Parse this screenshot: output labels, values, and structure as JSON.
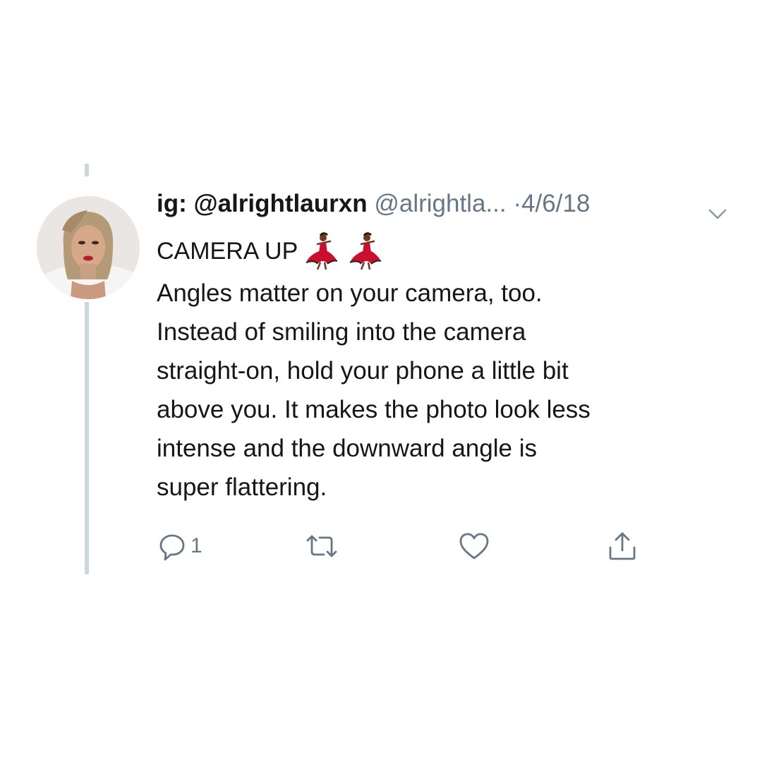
{
  "tweet": {
    "display_name": "ig: @alrightlaurxn",
    "handle": "@alrightla...",
    "separator": "·",
    "date": "4/6/18",
    "title_text": "CAMERA UP",
    "title_emojis": [
      "dancer-emoji",
      "dancer-emoji"
    ],
    "body_lines": [
      "Angles matter on your camera, too.",
      "Instead of smiling into the camera",
      "straight-on, hold your phone a little bit",
      "above you. It makes the photo look less",
      "intense and the downward angle is",
      "super flattering."
    ]
  },
  "actions": {
    "reply_icon": "speech-bubble-icon",
    "reply_count": "1",
    "retweet_icon": "retweet-icon",
    "like_icon": "heart-icon",
    "share_icon": "share-icon"
  },
  "colors": {
    "text_primary": "#14171a",
    "text_secondary": "#657786",
    "thread_line": "#ccd6dd",
    "background": "#ffffff"
  }
}
